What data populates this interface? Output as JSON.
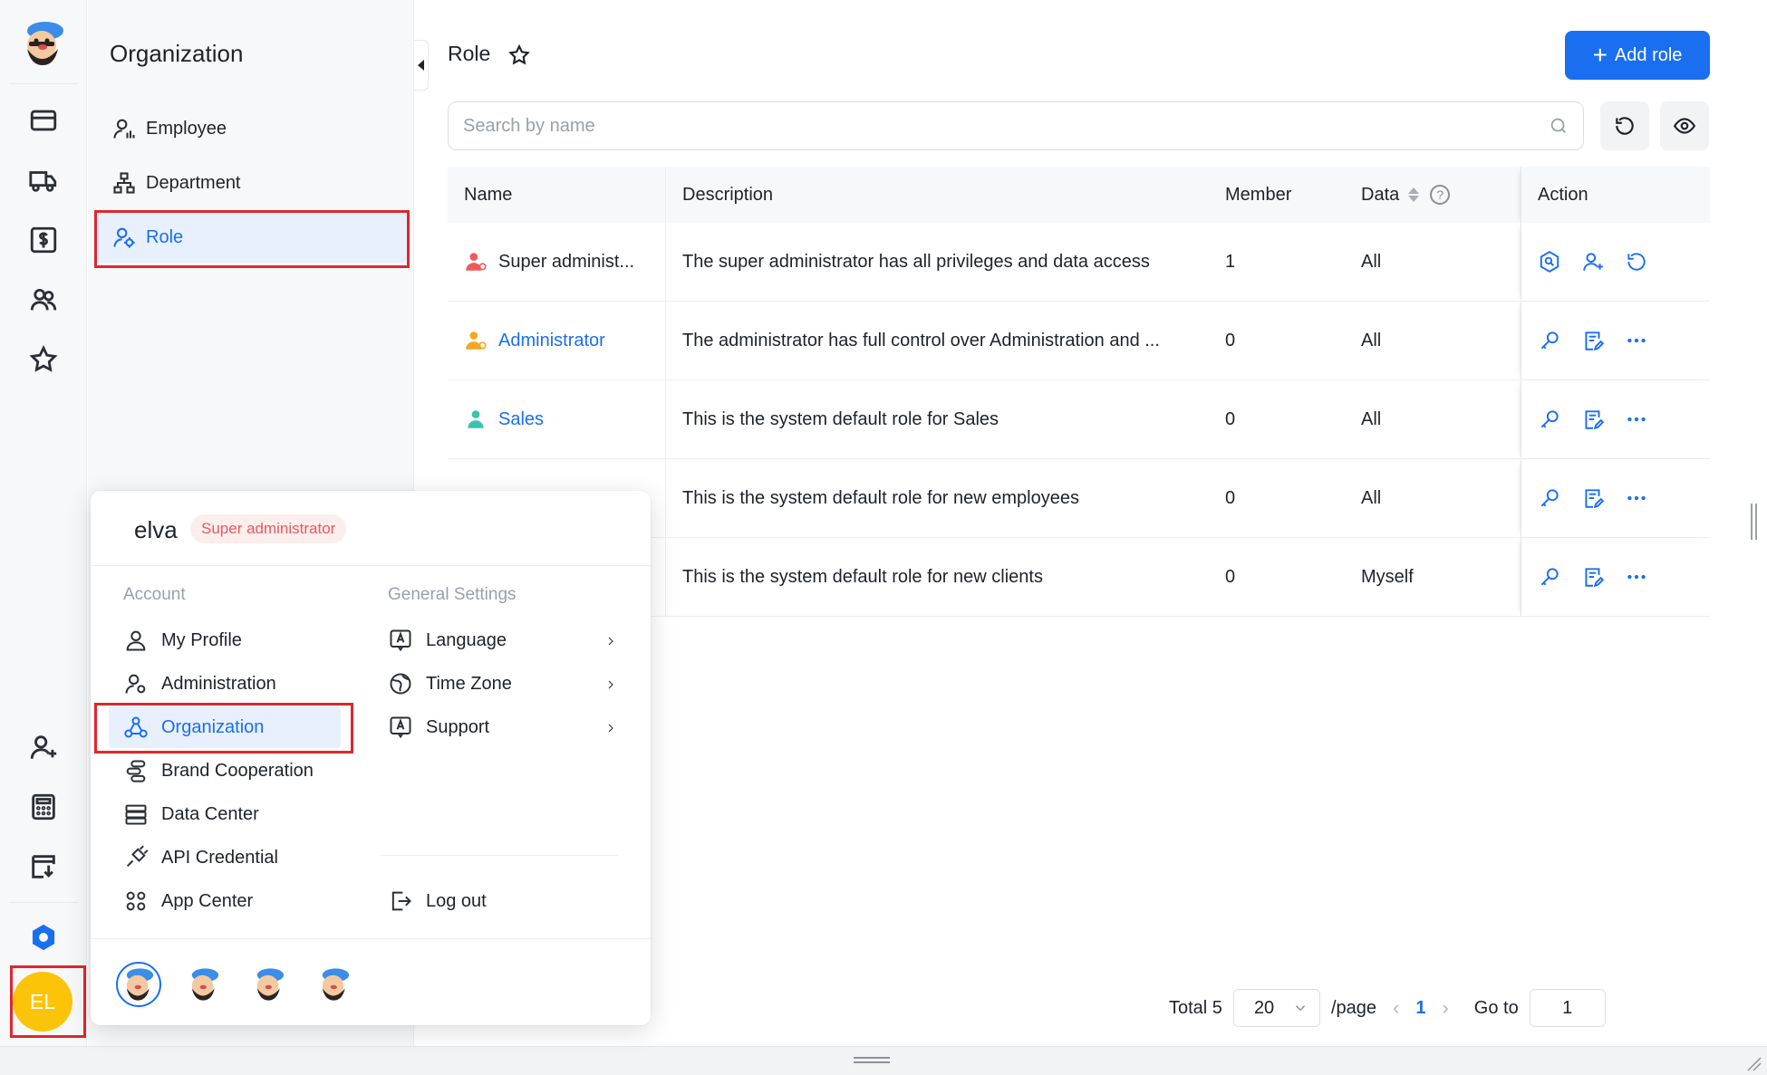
{
  "sidebar_rail": {
    "icons": [
      "card-icon",
      "truck-icon",
      "dollar-bill-icon",
      "users-icon",
      "star-icon",
      "add-user-icon",
      "calculator-icon",
      "download-box-icon",
      "settings-icon"
    ],
    "avatar_initials": "EL"
  },
  "org_panel": {
    "title": "Organization",
    "items": [
      {
        "label": "Employee",
        "icon": "employee-icon"
      },
      {
        "label": "Department",
        "icon": "department-icon"
      },
      {
        "label": "Role",
        "icon": "role-icon",
        "active": true
      }
    ]
  },
  "main": {
    "title": "Role",
    "add_button_label": "Add role",
    "search_placeholder": "Search by name"
  },
  "table": {
    "columns": [
      "Name",
      "Description",
      "Member",
      "Data",
      "Action"
    ],
    "rows": [
      {
        "name": "Super administ...",
        "description": "The super administrator has all privileges and data access",
        "member": "1",
        "data": "All",
        "icon_color": "#f05a5a",
        "link": false
      },
      {
        "name": "Administrator",
        "description": "The administrator has full control over Administration and ...",
        "member": "0",
        "data": "All",
        "icon_color": "#f5a623",
        "link": true
      },
      {
        "name": "Sales",
        "description": "This is the system default role for Sales",
        "member": "0",
        "data": "All",
        "icon_color": "#3cc0b4",
        "link": true
      },
      {
        "name": "",
        "description": "This is the system default role for new employees",
        "member": "0",
        "data": "All",
        "icon_color": "#3cc0b4",
        "link": true
      },
      {
        "name": "",
        "description": "This is the system default role for new clients",
        "member": "0",
        "data": "Myself",
        "icon_color": "#3cc0b4",
        "link": true
      }
    ]
  },
  "pagination": {
    "total": "Total 5",
    "page_size": "20",
    "per_page": "/page",
    "current": "1",
    "goto_label": "Go to",
    "goto_value": "1"
  },
  "popup": {
    "user_name": "elva",
    "user_role": "Super administrator",
    "account_title": "Account",
    "settings_title": "General Settings",
    "account_items": [
      "My Profile",
      "Administration",
      "Organization",
      "Brand Cooperation",
      "Data Center",
      "API Credential",
      "App Center"
    ],
    "settings_items": [
      "Language",
      "Time Zone",
      "Support"
    ],
    "logout": "Log out"
  },
  "colors": {
    "accent": "#1a6ff0",
    "highlight": "#e0262d",
    "avatar": "#fcc409"
  }
}
